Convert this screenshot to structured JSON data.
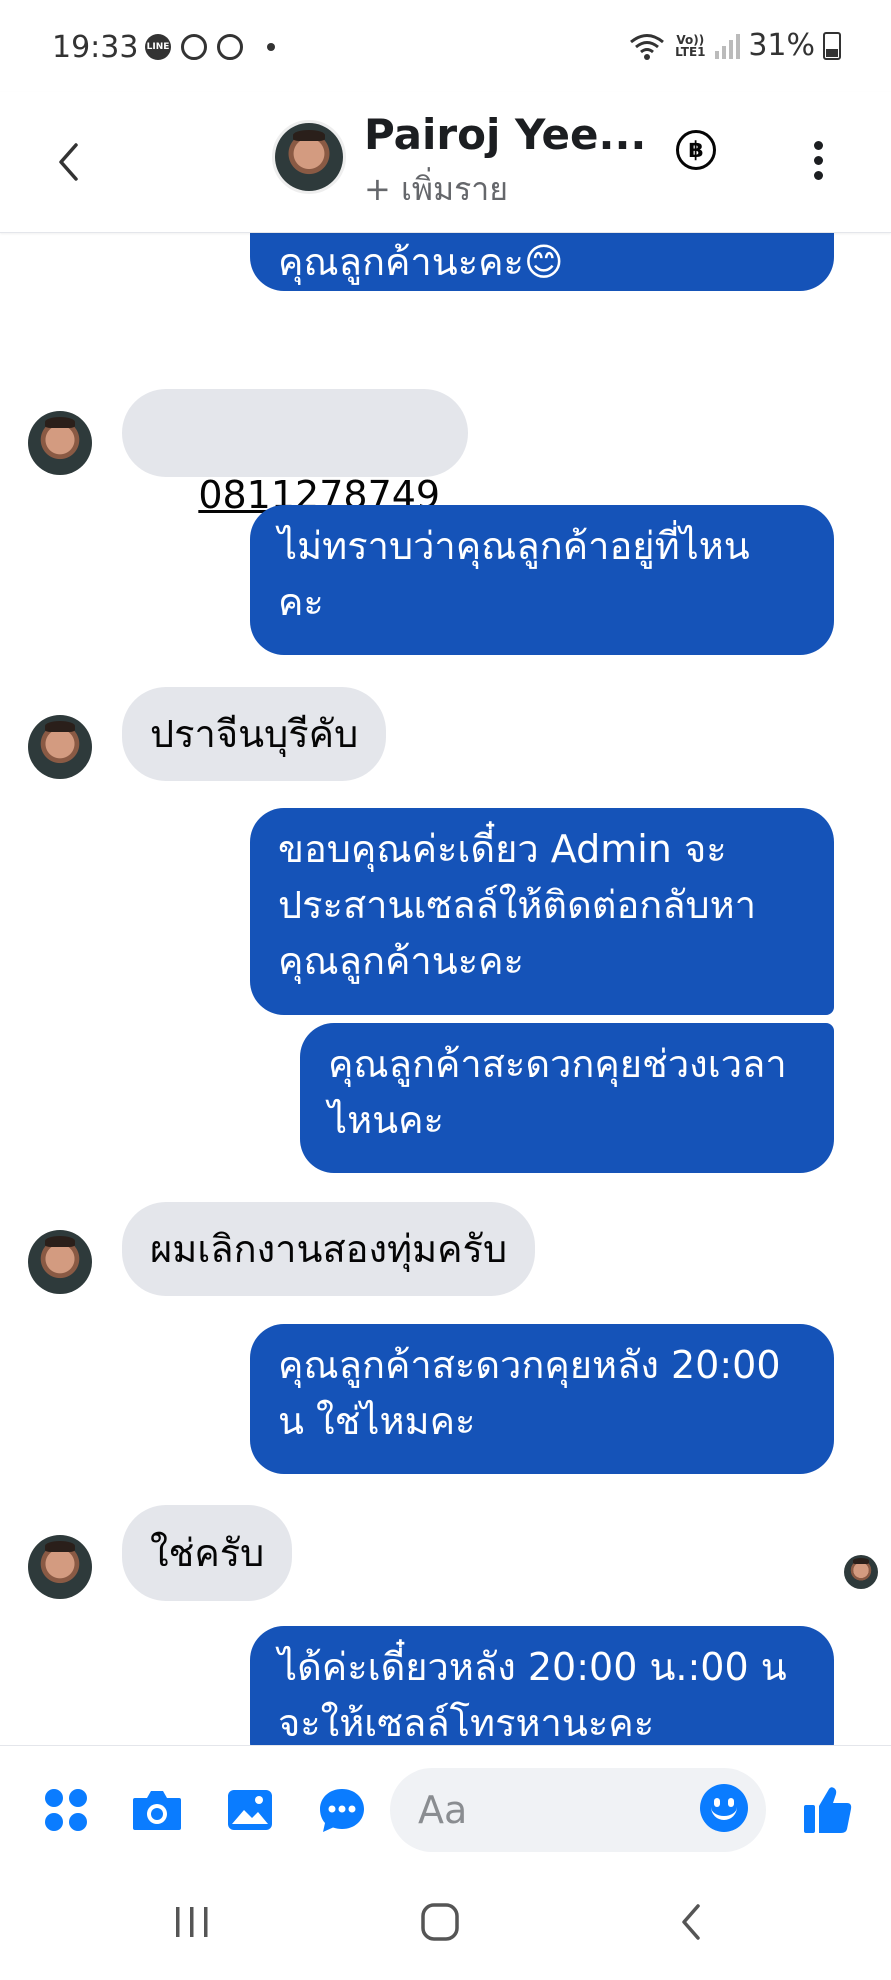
{
  "status_bar": {
    "time": "19:33",
    "battery": "31%",
    "network": "Vo)) LTE1",
    "notification_icons": [
      "line-icon",
      "play-circle-icon",
      "play-icon"
    ]
  },
  "header": {
    "title": "Pairoj Yee...",
    "subtitle": "+ เพิ่มราย",
    "icons": [
      "back-icon",
      "baht-icon",
      "more-icon"
    ]
  },
  "messages": [
    {
      "dir": "out",
      "text": "แจ้งรายละเอียดเพิ่มเติมให้แก่\nคุณลูกค้านะคะ😊"
    },
    {
      "dir": "in",
      "text": "0811278749",
      "link": true
    },
    {
      "dir": "out",
      "text": "ไม่ทราบว่าคุณลูกค้าอยู่ที่ไหน\nคะ"
    },
    {
      "dir": "in",
      "text": "ปราจีนบุรีคับ"
    },
    {
      "dir": "out",
      "text": "ขอบคุณค่ะเดี๋ยว Admin จะ\nประสานเซลล์ให้ติดต่อกลับหา\nคุณลูกค้านะคะ"
    },
    {
      "dir": "out",
      "text": "คุณลูกค้าสะดวกคุยช่วงเวลา\nไหนคะ"
    },
    {
      "dir": "in",
      "text": "ผมเลิกงานสองทุ่มครับ"
    },
    {
      "dir": "out",
      "text": "คุณลูกค้าสะดวกคุยหลัง 20:00\nน ใช่ไหมคะ"
    },
    {
      "dir": "in",
      "text": "ใช่ครับ"
    },
    {
      "dir": "out",
      "text": "ได้ค่ะเดี๋ยวหลัง 20:00 น.:00 น\nจะให้เซลล์โทรหานะคะ"
    }
  ],
  "composer": {
    "placeholder": "Aa",
    "icons": [
      "apps-icon",
      "camera-icon",
      "gallery-icon",
      "chat-bubble-icon",
      "emoji-icon",
      "like-icon"
    ]
  },
  "navbar": {
    "icons": [
      "recent-apps-icon",
      "home-icon",
      "back-icon"
    ]
  },
  "colors": {
    "outgoing_bubble": "#1553b8",
    "incoming_bubble": "#e4e6eb",
    "accent": "#0a7cff"
  }
}
